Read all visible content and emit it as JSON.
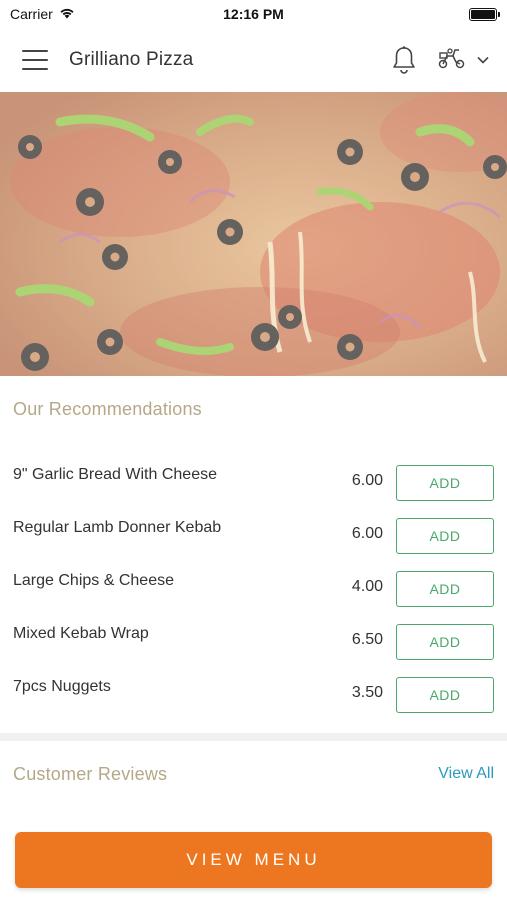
{
  "status_bar": {
    "carrier": "Carrier",
    "time": "12:16 PM"
  },
  "header": {
    "title": "Grilliano Pizza",
    "icons": [
      "menu-icon",
      "bell-icon",
      "scooter-icon",
      "chevron-down-icon"
    ]
  },
  "hero": {
    "image": "pizza-photo"
  },
  "recommendations": {
    "title": "Our Recommendations",
    "items": [
      {
        "name": "9\" Garlic Bread With Cheese",
        "price": "6.00",
        "action": "ADD"
      },
      {
        "name": "Regular Lamb Donner Kebab",
        "price": "6.00",
        "action": "ADD"
      },
      {
        "name": "Large Chips & Cheese",
        "price": "4.00",
        "action": "ADD"
      },
      {
        "name": "Mixed Kebab Wrap",
        "price": "6.50",
        "action": "ADD"
      },
      {
        "name": "7pcs Nuggets",
        "price": "3.50",
        "action": "ADD"
      }
    ]
  },
  "reviews": {
    "title": "Customer Reviews",
    "view_all": "View All"
  },
  "footer": {
    "view_menu": "VIEW MENU"
  },
  "colors": {
    "accent": "#ec7720",
    "add_green": "#4aa86a",
    "link_blue": "#2a9bbd",
    "section_title": "#b5a888"
  }
}
